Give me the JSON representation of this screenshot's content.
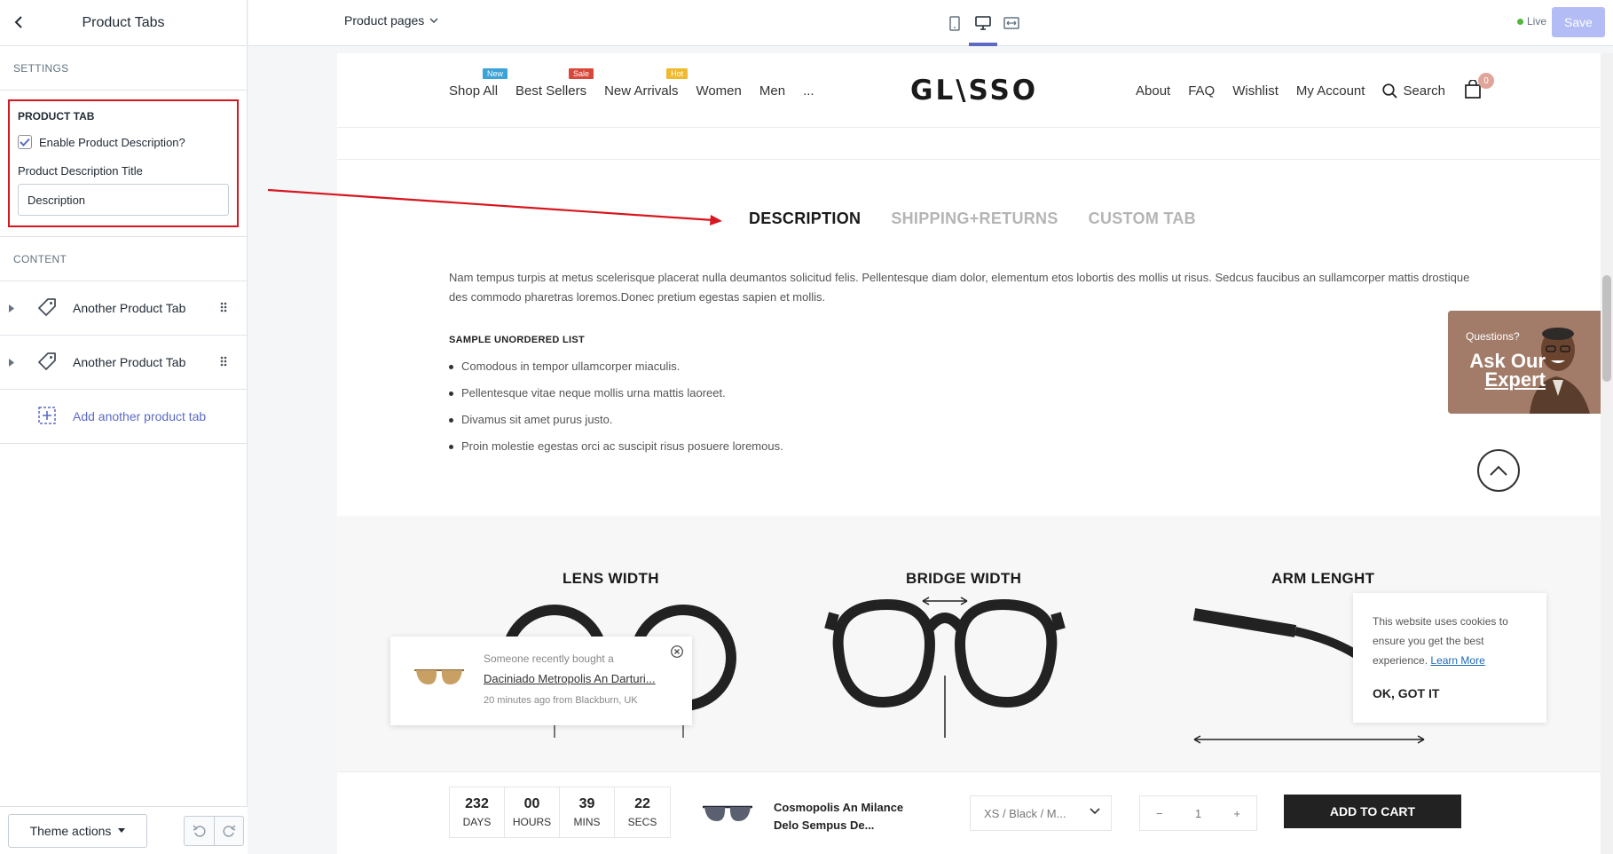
{
  "sidebar": {
    "title": "Product Tabs",
    "settings_label": "SETTINGS",
    "product_tab_heading": "PRODUCT TAB",
    "enable_desc_label": "Enable Product Description?",
    "enable_desc_checked": true,
    "desc_title_label": "Product Description Title",
    "desc_title_value": "Description",
    "content_label": "CONTENT",
    "content_items": [
      {
        "label": "Another Product Tab"
      },
      {
        "label": "Another Product Tab"
      }
    ],
    "add_label": "Add another product tab",
    "theme_actions": "Theme actions"
  },
  "topbar": {
    "page_selector": "Product pages",
    "live_label": "Live",
    "save_label": "Save",
    "active_view": "desktop",
    "accent": "#5c6ac4"
  },
  "store": {
    "nav_left": [
      {
        "label": "Shop All",
        "badge": "New",
        "badge_color": "#3aa3d8"
      },
      {
        "label": "Best Sellers",
        "badge": "Sale",
        "badge_color": "#d9473a"
      },
      {
        "label": "New Arrivals",
        "badge": "Hot",
        "badge_color": "#f0b92f"
      },
      {
        "label": "Women",
        "badge": "",
        "badge_color": ""
      },
      {
        "label": "Men",
        "badge": "",
        "badge_color": ""
      },
      {
        "label": "...",
        "badge": "",
        "badge_color": ""
      }
    ],
    "logo": "GL\\SSO",
    "nav_right": [
      "About",
      "FAQ",
      "Wishlist",
      "My Account"
    ],
    "search_label": "Search",
    "cart_count": "0",
    "tabs": [
      "DESCRIPTION",
      "SHIPPING+RETURNS",
      "CUSTOM TAB"
    ],
    "active_tab": "DESCRIPTION",
    "description": "Nam tempus turpis at metus scelerisque placerat nulla deumantos solicitud felis. Pellentesque diam dolor, elementum etos lobortis des mollis ut risus. Sedcus faucibus an sullamcorper mattis drostique des commodo pharetras loremos.Donec pretium egestas sapien et mollis.",
    "list_title": "SAMPLE UNORDERED LIST",
    "list_items": [
      "Comodous in tempor ullamcorper miaculis.",
      "Pellentesque vitae neque mollis urna mattis laoreet.",
      "Divamus sit amet purus justo.",
      "Proin molestie egestas orci ac suscipit risus posuere loremous."
    ],
    "expert_question": "Questions?",
    "expert_line1": "Ask Our",
    "expert_line2": "Expert",
    "size_titles": [
      "LENS WIDTH",
      "BRIDGE WIDTH",
      "ARM LENGHT"
    ],
    "toast": {
      "line1": "Someone recently bought a",
      "product": "Daciniado Metropolis An Darturi...",
      "time": "20 minutes ago from Blackburn, UK"
    },
    "cookie": {
      "text": "This website uses cookies to ensure you get the best experience.",
      "link": "Learn More",
      "ok": "OK, GOT IT"
    },
    "sticky": {
      "countdown": [
        {
          "value": "232",
          "unit": "DAYS"
        },
        {
          "value": "00",
          "unit": "HOURS"
        },
        {
          "value": "39",
          "unit": "MINS"
        },
        {
          "value": "22",
          "unit": "SECS"
        }
      ],
      "product_name": "Cosmopolis An Milance Delo Sempus De...",
      "variant": "XS / Black / M...",
      "quantity": "1",
      "add_to_cart": "ADD TO CART"
    }
  }
}
